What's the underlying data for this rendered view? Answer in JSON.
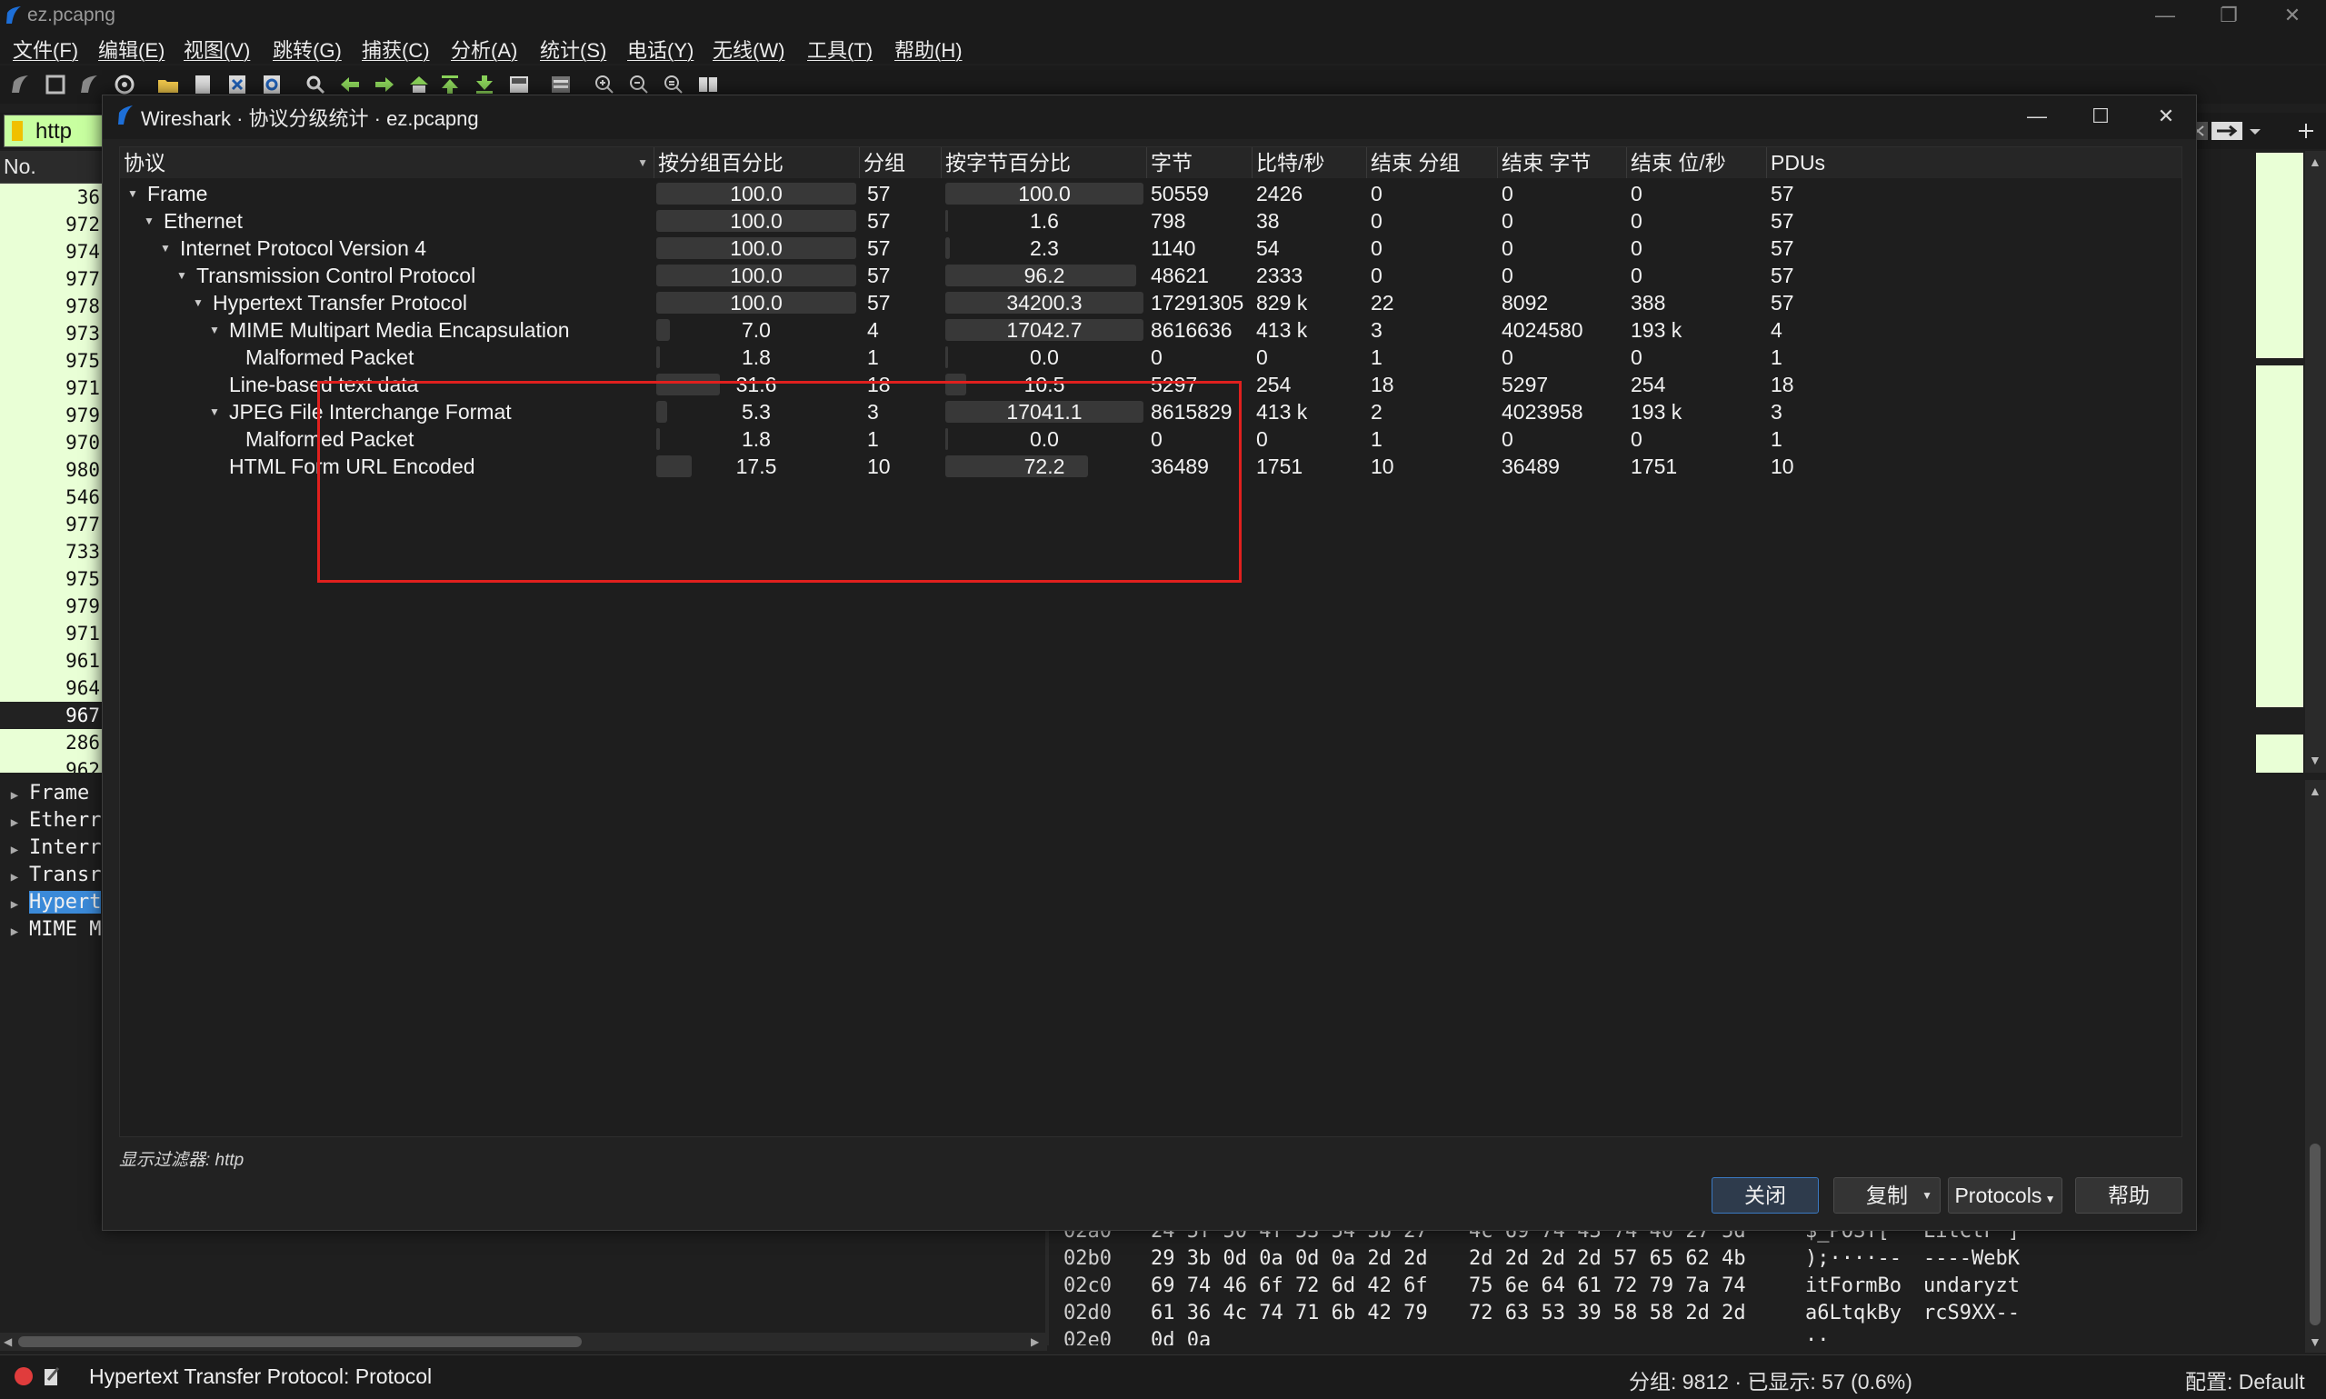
{
  "main_window": {
    "title": "ez.pcapng",
    "menu": [
      "文件(F)",
      "编辑(E)",
      "视图(V)",
      "跳转(G)",
      "捕获(C)",
      "分析(A)",
      "统计(S)",
      "电话(Y)",
      "无线(W)",
      "工具(T)",
      "帮助(H)"
    ],
    "display_filter": "http",
    "packet_list": {
      "column_no": "No.",
      "rows": [
        "36",
        "972",
        "974",
        "977",
        "978",
        "973",
        "975",
        "971",
        "979",
        "970",
        "980",
        "546",
        "977",
        "733",
        "975",
        "979",
        "971",
        "961",
        "964",
        "967",
        "286",
        "962"
      ],
      "selected_index": 19
    },
    "details": [
      {
        "label": "Frame",
        "selected": false
      },
      {
        "label": "Etherr",
        "selected": false
      },
      {
        "label": "Interr",
        "selected": false
      },
      {
        "label": "Transr",
        "selected": false
      },
      {
        "label": "Hypert",
        "selected": true
      },
      {
        "label": "MIME M",
        "selected": false
      }
    ],
    "hex": [
      {
        "offset": "02a0",
        "b1": "24 5f 50 4f 53 54 5b 27",
        "b2": "4c 69 74 43 74 40 27 5d",
        "a1": "$_POST['",
        "a2": "LitCtF']"
      },
      {
        "offset": "02b0",
        "b1": "29 3b 0d 0a 0d 0a 2d 2d",
        "b2": "2d 2d 2d 2d 57 65 62 4b",
        "a1": ");····--",
        "a2": "----WebK"
      },
      {
        "offset": "02c0",
        "b1": "69 74 46 6f 72 6d 42 6f",
        "b2": "75 6e 64 61 72 79 7a 74",
        "a1": "itFormBo",
        "a2": "undaryzt"
      },
      {
        "offset": "02d0",
        "b1": "61 36 4c 74 71 6b 42 79",
        "b2": "72 63 53 39 58 58 2d 2d",
        "a1": "a6LtqkBy",
        "a2": "rcS9XX--"
      },
      {
        "offset": "02e0",
        "b1": "0d 0a",
        "b2": "",
        "a1": "··",
        "a2": ""
      }
    ],
    "status": {
      "message": "Hypertext Transfer Protocol: Protocol",
      "stats": "分组: 9812 · 已显示: 57 (0.6%)",
      "profile": "配置:  Default"
    }
  },
  "dialog": {
    "title": "Wireshark · 协议分级统计 · ez.pcapng",
    "columns": [
      "协议",
      "按分组百分比",
      "分组",
      "按字节百分比",
      "字节",
      "比特/秒",
      "结束 分组",
      "结束 字节",
      "结束 位/秒",
      "PDUs"
    ],
    "rows": [
      {
        "protocol": "Frame",
        "level": 0,
        "expanded": true,
        "pct_packets": "100.0",
        "packets": "57",
        "pct_bytes": "100.0",
        "bytes": "50559",
        "bits_s": "2426",
        "end_packets": "0",
        "end_bytes": "0",
        "end_bits_s": "0",
        "pdus": "57",
        "pct_packets_fill": 1.0,
        "pct_bytes_fill": 1.0
      },
      {
        "protocol": "Ethernet",
        "level": 1,
        "expanded": true,
        "pct_packets": "100.0",
        "packets": "57",
        "pct_bytes": "1.6",
        "bytes": "798",
        "bits_s": "38",
        "end_packets": "0",
        "end_bytes": "0",
        "end_bits_s": "0",
        "pdus": "57",
        "pct_packets_fill": 1.0,
        "pct_bytes_fill": 0.016
      },
      {
        "protocol": "Internet Protocol Version 4",
        "level": 2,
        "expanded": true,
        "pct_packets": "100.0",
        "packets": "57",
        "pct_bytes": "2.3",
        "bytes": "1140",
        "bits_s": "54",
        "end_packets": "0",
        "end_bytes": "0",
        "end_bits_s": "0",
        "pdus": "57",
        "pct_packets_fill": 1.0,
        "pct_bytes_fill": 0.023
      },
      {
        "protocol": "Transmission Control Protocol",
        "level": 3,
        "expanded": true,
        "pct_packets": "100.0",
        "packets": "57",
        "pct_bytes": "96.2",
        "bytes": "48621",
        "bits_s": "2333",
        "end_packets": "0",
        "end_bytes": "0",
        "end_bits_s": "0",
        "pdus": "57",
        "pct_packets_fill": 1.0,
        "pct_bytes_fill": 0.962
      },
      {
        "protocol": "Hypertext Transfer Protocol",
        "level": 4,
        "expanded": true,
        "pct_packets": "100.0",
        "packets": "57",
        "pct_bytes": "34200.3",
        "bytes": "17291305",
        "bits_s": "829 k",
        "end_packets": "22",
        "end_bytes": "8092",
        "end_bits_s": "388",
        "pdus": "57",
        "pct_packets_fill": 1.0,
        "pct_bytes_fill": 1.0
      },
      {
        "protocol": "MIME Multipart Media Encapsulation",
        "level": 5,
        "expanded": true,
        "pct_packets": "7.0",
        "packets": "4",
        "pct_bytes": "17042.7",
        "bytes": "8616636",
        "bits_s": "413 k",
        "end_packets": "3",
        "end_bytes": "4024580",
        "end_bits_s": "193 k",
        "pdus": "4",
        "pct_packets_fill": 0.07,
        "pct_bytes_fill": 1.0
      },
      {
        "protocol": "Malformed Packet",
        "level": 6,
        "expanded": null,
        "pct_packets": "1.8",
        "packets": "1",
        "pct_bytes": "0.0",
        "bytes": "0",
        "bits_s": "0",
        "end_packets": "1",
        "end_bytes": "0",
        "end_bits_s": "0",
        "pdus": "1",
        "pct_packets_fill": 0.018,
        "pct_bytes_fill": 0.0
      },
      {
        "protocol": "Line-based text data",
        "level": 5,
        "expanded": null,
        "pct_packets": "31.6",
        "packets": "18",
        "pct_bytes": "10.5",
        "bytes": "5297",
        "bits_s": "254",
        "end_packets": "18",
        "end_bytes": "5297",
        "end_bits_s": "254",
        "pdus": "18",
        "pct_packets_fill": 0.316,
        "pct_bytes_fill": 0.105
      },
      {
        "protocol": "JPEG File Interchange Format",
        "level": 5,
        "expanded": true,
        "pct_packets": "5.3",
        "packets": "3",
        "pct_bytes": "17041.1",
        "bytes": "8615829",
        "bits_s": "413 k",
        "end_packets": "2",
        "end_bytes": "4023958",
        "end_bits_s": "193 k",
        "pdus": "3",
        "pct_packets_fill": 0.053,
        "pct_bytes_fill": 1.0
      },
      {
        "protocol": "Malformed Packet",
        "level": 6,
        "expanded": null,
        "pct_packets": "1.8",
        "packets": "1",
        "pct_bytes": "0.0",
        "bytes": "0",
        "bits_s": "0",
        "end_packets": "1",
        "end_bytes": "0",
        "end_bits_s": "0",
        "pdus": "1",
        "pct_packets_fill": 0.018,
        "pct_bytes_fill": 0.0
      },
      {
        "protocol": "HTML Form URL Encoded",
        "level": 5,
        "expanded": null,
        "pct_packets": "17.5",
        "packets": "10",
        "pct_bytes": "72.2",
        "bytes": "36489",
        "bits_s": "1751",
        "end_packets": "10",
        "end_bytes": "36489",
        "end_bits_s": "1751",
        "pdus": "10",
        "pct_packets_fill": 0.175,
        "pct_bytes_fill": 0.722
      }
    ],
    "filter_note": "显示过滤器: http",
    "buttons": {
      "close": "关闭",
      "copy": "复制",
      "protocols": "Protocols",
      "help": "帮助"
    },
    "highlight_color": "#e0201e",
    "accent_color": "#3b8ad9"
  }
}
